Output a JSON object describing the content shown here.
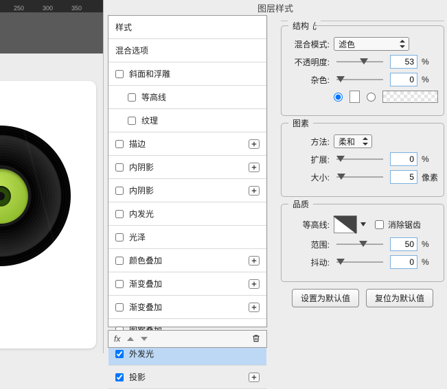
{
  "ruler": {
    "t250": "250",
    "t300": "300",
    "t350": "350"
  },
  "dialog_title": "图层样式",
  "styles": {
    "header": "样式",
    "blend_options": "混合选项",
    "bevel": "斜面和浮雕",
    "contour": "等高线",
    "texture": "纹理",
    "stroke": "描边",
    "inner_shadow1": "内阴影",
    "inner_shadow2": "内阴影",
    "inner_glow": "内发光",
    "satin": "光泽",
    "color_overlay": "颜色叠加",
    "gradient_overlay1": "渐变叠加",
    "gradient_overlay2": "渐变叠加",
    "pattern_overlay": "图案叠加",
    "outer_glow": "外发光",
    "drop_shadow": "投影",
    "fx": "fx"
  },
  "panel": {
    "section_title": "外发光",
    "structure": {
      "title": "结构",
      "blend_mode_label": "混合模式:",
      "blend_mode_value": "滤色",
      "opacity_label": "不透明度:",
      "opacity_value": "53",
      "opacity_unit": "%",
      "noise_label": "杂色:",
      "noise_value": "0",
      "noise_unit": "%"
    },
    "elements": {
      "title": "图素",
      "technique_label": "方法:",
      "technique_value": "柔和",
      "spread_label": "扩展:",
      "spread_value": "0",
      "spread_unit": "%",
      "size_label": "大小:",
      "size_value": "5",
      "size_unit": "像素"
    },
    "quality": {
      "title": "品质",
      "contour_label": "等高线:",
      "antialias": "消除锯齿",
      "range_label": "范围:",
      "range_value": "50",
      "range_unit": "%",
      "jitter_label": "抖动:",
      "jitter_value": "0",
      "jitter_unit": "%"
    },
    "buttons": {
      "set_default": "设置为默认值",
      "reset_default": "复位为默认值"
    }
  }
}
